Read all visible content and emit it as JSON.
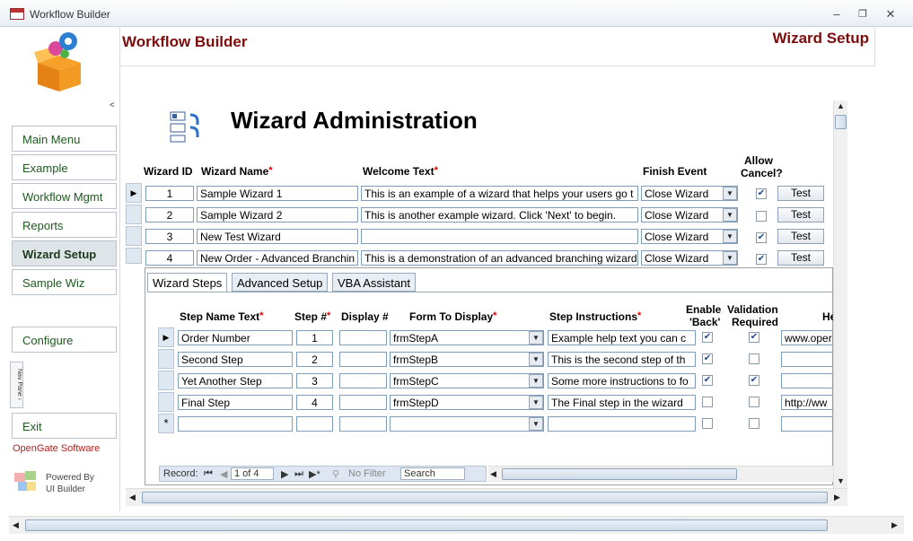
{
  "window": {
    "title": "Workflow Builder",
    "minimize": "–",
    "restore": "❐",
    "close": "✕"
  },
  "sidebar": {
    "collapse_glyph": "<",
    "items": [
      {
        "label": "Main Menu",
        "active": false
      },
      {
        "label": "Example",
        "active": false
      },
      {
        "label": "Workflow Mgmt",
        "active": false
      },
      {
        "label": "Reports",
        "active": false
      },
      {
        "label": "Wizard Setup",
        "active": true
      },
      {
        "label": "Sample Wiz",
        "active": false
      }
    ],
    "configure": "Configure",
    "nav_pane": "Nav Pane ›",
    "exit": "Exit",
    "brand": "OpenGate Software",
    "powered_line1": "Powered By",
    "powered_line2": "UI Builder"
  },
  "header": {
    "left_title": "Workflow Builder",
    "right_title": "Wizard Setup"
  },
  "main": {
    "title": "Wizard Administration",
    "columns": {
      "wizard_id": "Wizard ID",
      "wizard_name": "Wizard Name",
      "welcome_text": "Welcome Text",
      "finish_event": "Finish Event",
      "allow_cancel_1": "Allow",
      "allow_cancel_2": "Cancel?",
      "required_mark": "*"
    },
    "test_label": "Test",
    "wizards": [
      {
        "id": "1",
        "name": "Sample Wizard 1",
        "welcome": "This is an example of a wizard that helps your users go t",
        "finish": "Close Wizard",
        "allow_cancel": true
      },
      {
        "id": "2",
        "name": "Sample Wizard 2",
        "welcome": "This is another example wizard.  Click 'Next' to begin.",
        "finish": "Close Wizard",
        "allow_cancel": false
      },
      {
        "id": "3",
        "name": "New Test Wizard",
        "welcome": "",
        "finish": "Close Wizard",
        "allow_cancel": true
      },
      {
        "id": "4",
        "name": "New Order - Advanced Branchin",
        "welcome": "This is a demonstration of an advanced branching wizard",
        "finish": "Close Wizard",
        "allow_cancel": true
      }
    ]
  },
  "subform": {
    "tabs": [
      "Wizard Steps",
      "Advanced Setup",
      "VBA Assistant"
    ],
    "columns": {
      "step_name": "Step Name Text",
      "step_no": "Step #",
      "display_no": "Display #",
      "form": "Form To Display",
      "instructions": "Step Instructions",
      "enable_back_1": "Enable",
      "enable_back_2": "'Back'",
      "validation_1": "Validation",
      "validation_2": "Required",
      "help": "He"
    },
    "new_row_marker": "*",
    "steps": [
      {
        "name": "Order Number",
        "step": "1",
        "display": "",
        "form": "frmStepA",
        "instructions": "Example help text you can c",
        "back": true,
        "validation": true,
        "help": "www.oper"
      },
      {
        "name": "Second Step",
        "step": "2",
        "display": "",
        "form": "frmStepB",
        "instructions": "This is the second step of th",
        "back": true,
        "validation": false,
        "help": ""
      },
      {
        "name": "Yet Another Step",
        "step": "3",
        "display": "",
        "form": "frmStepC",
        "instructions": "Some more instructions to fo",
        "back": true,
        "validation": true,
        "help": ""
      },
      {
        "name": "Final Step",
        "step": "4",
        "display": "",
        "form": "frmStepD",
        "instructions": "The Final step in the wizard",
        "back": false,
        "validation": false,
        "help": "http://ww"
      }
    ],
    "record_bar": {
      "label": "Record:",
      "position": "1 of 4",
      "filter": "No Filter",
      "search": "Search"
    }
  },
  "colors": {
    "header_red": "#7c0c0c",
    "nav_green": "#1e5a1e",
    "brand_red": "#b32020"
  }
}
